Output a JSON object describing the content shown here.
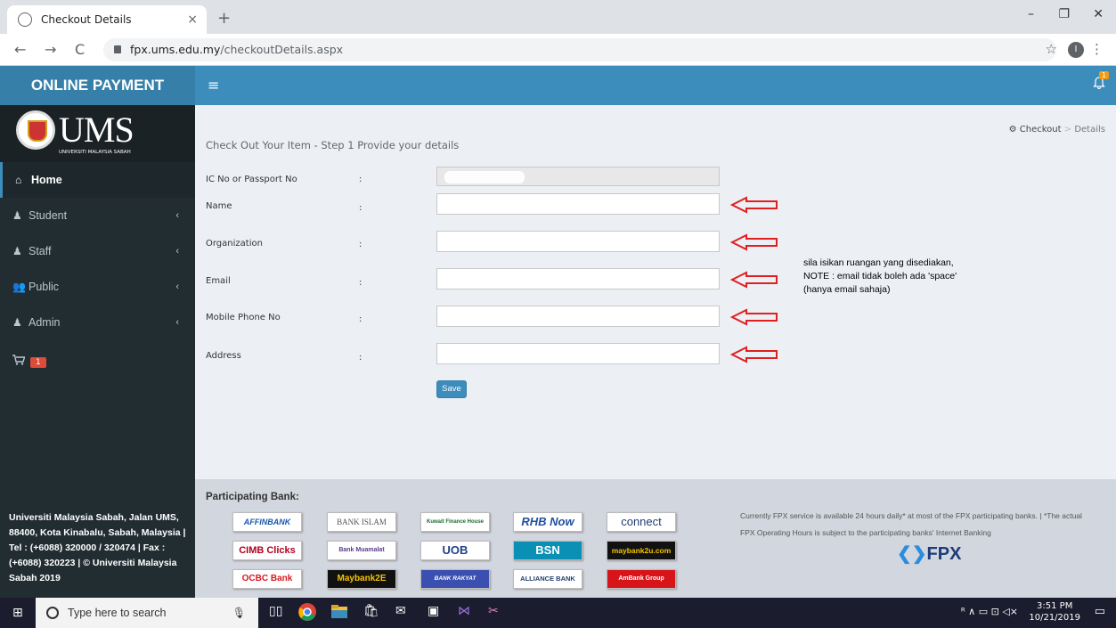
{
  "browser": {
    "tab_title": "Checkout Details",
    "tab_close": "×",
    "new_tab": "+",
    "url_domain": "fpx.ums.edu.my",
    "url_path": "/checkoutDetails.aspx",
    "win_min": "–",
    "win_restore": "❐",
    "win_close": "✕",
    "back": "←",
    "forward": "→",
    "reload": "C",
    "bookmark": "☆",
    "profile": "I",
    "menu": "⋮"
  },
  "header": {
    "brand": "ONLINE PAYMENT",
    "menu_toggle": "≡",
    "bell": "🔔",
    "bell_count": "1"
  },
  "sidebar": {
    "logo_text": "UMS",
    "logo_sub": "UNIVERSITI MALAYSIA SABAH",
    "items": [
      {
        "label": "Home",
        "icon": "⌂"
      },
      {
        "label": "Student",
        "icon": "♟",
        "chevron": "‹"
      },
      {
        "label": "Staff",
        "icon": "♟",
        "chevron": "‹"
      },
      {
        "label": "Public",
        "icon": "👥",
        "chevron": "‹"
      },
      {
        "label": "Admin",
        "icon": "♟",
        "chevron": "‹"
      }
    ],
    "cart_icon": "🛒",
    "cart_count": "1",
    "footer": "Universiti Malaysia Sabah, Jalan UMS, 88400, Kota Kinabalu, Sabah, Malaysia | Tel : (+6088) 320000 / 320474 | Fax : (+6088) 320223 | © Universiti Malaysia Sabah 2019"
  },
  "content": {
    "title": "Check Out Your Item - Step 1 Provide your details",
    "breadcrumb": {
      "home": "Checkout",
      "sep": ">",
      "current": "Details"
    },
    "colon": ":",
    "fields": [
      {
        "label": "IC No or Passport No",
        "value": ""
      },
      {
        "label": "Name",
        "value": ""
      },
      {
        "label": "Organization",
        "value": ""
      },
      {
        "label": "Email",
        "value": ""
      },
      {
        "label": "Mobile Phone No",
        "value": ""
      },
      {
        "label": "Address",
        "value": ""
      }
    ],
    "note_lines": [
      "sila isikan ruangan yang disediakan,",
      "NOTE : email tidak boleh ada 'space'",
      "(hanya email sahaja)"
    ],
    "save_label": "Save",
    "annotation_color": "#e02020"
  },
  "footer": {
    "title": "Participating Bank:",
    "banks": [
      {
        "name": "AFFINBANK",
        "color": "#1a57a8"
      },
      {
        "name": "BANK ISLAM",
        "color": "#555"
      },
      {
        "name": "Kuwait Finance House",
        "color": "#1b6b2d"
      },
      {
        "name": "RHB Now",
        "color": "#1f4fa0"
      },
      {
        "name": "connect",
        "color": "#233c74"
      },
      {
        "name": "CIMB Clicks",
        "color": "#b0001f"
      },
      {
        "name": "Bank Muamalat",
        "color": "#5a3b8c"
      },
      {
        "name": "UOB",
        "color": "#1f3f8a"
      },
      {
        "name": "BSN",
        "color": "#ffffff"
      },
      {
        "name": "maybank2u.com",
        "color": "#f5c400"
      },
      {
        "name": "OCBC Bank",
        "color": "#d71920"
      },
      {
        "name": "Maybank2E",
        "color": "#f5c400"
      },
      {
        "name": "BANK RAKYAT",
        "color": "#ffffff"
      },
      {
        "name": "ALLIANCE BANK",
        "color": "#1f3f6e"
      },
      {
        "name": "AmBank Group",
        "color": "#ffffff"
      }
    ],
    "fpx_text": "Currently FPX service is available 24 hours daily* at most of the FPX participating banks. | *The actual FPX Operating Hours is subject to the participating banks' Internet Banking",
    "fpx_logo": "FPX"
  },
  "taskbar": {
    "start": "⊞",
    "search_placeholder": "Type here to search",
    "mic": "🎙",
    "time": "3:51 PM",
    "date": "10/21/2019",
    "tray": "ᴿ ∧ ▭ ⊡ ◁×",
    "notification": "▭"
  }
}
